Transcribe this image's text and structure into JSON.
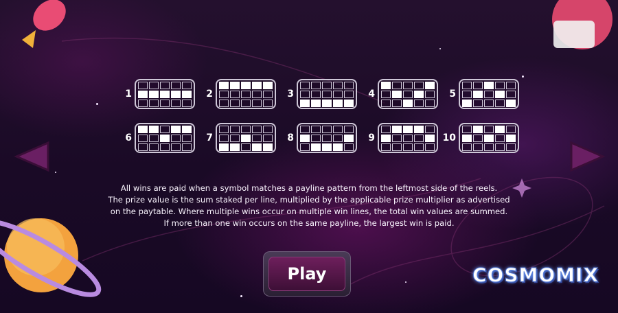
{
  "paylines": [
    {
      "number": "1",
      "rows": [
        [
          0,
          0,
          0,
          0,
          0
        ],
        [
          1,
          1,
          1,
          1,
          1
        ],
        [
          0,
          0,
          0,
          0,
          0
        ]
      ]
    },
    {
      "number": "2",
      "rows": [
        [
          1,
          1,
          1,
          1,
          1
        ],
        [
          0,
          0,
          0,
          0,
          0
        ],
        [
          0,
          0,
          0,
          0,
          0
        ]
      ]
    },
    {
      "number": "3",
      "rows": [
        [
          0,
          0,
          0,
          0,
          0
        ],
        [
          0,
          0,
          0,
          0,
          0
        ],
        [
          1,
          1,
          1,
          1,
          1
        ]
      ]
    },
    {
      "number": "4",
      "rows": [
        [
          1,
          0,
          0,
          0,
          1
        ],
        [
          0,
          1,
          0,
          1,
          0
        ],
        [
          0,
          0,
          1,
          0,
          0
        ]
      ]
    },
    {
      "number": "5",
      "rows": [
        [
          0,
          0,
          1,
          0,
          0
        ],
        [
          0,
          1,
          0,
          1,
          0
        ],
        [
          1,
          0,
          0,
          0,
          1
        ]
      ]
    },
    {
      "number": "6",
      "rows": [
        [
          1,
          1,
          0,
          1,
          1
        ],
        [
          0,
          0,
          1,
          0,
          0
        ],
        [
          0,
          0,
          0,
          0,
          0
        ]
      ]
    },
    {
      "number": "7",
      "rows": [
        [
          0,
          0,
          0,
          0,
          0
        ],
        [
          0,
          0,
          1,
          0,
          0
        ],
        [
          1,
          1,
          0,
          1,
          1
        ]
      ]
    },
    {
      "number": "8",
      "rows": [
        [
          0,
          0,
          0,
          0,
          0
        ],
        [
          1,
          0,
          0,
          0,
          1
        ],
        [
          0,
          1,
          1,
          1,
          0
        ]
      ]
    },
    {
      "number": "9",
      "rows": [
        [
          0,
          1,
          1,
          1,
          0
        ],
        [
          1,
          0,
          0,
          0,
          1
        ],
        [
          0,
          0,
          0,
          0,
          0
        ]
      ]
    },
    {
      "number": "10",
      "rows": [
        [
          0,
          1,
          0,
          1,
          0
        ],
        [
          1,
          0,
          1,
          0,
          1
        ],
        [
          0,
          0,
          0,
          0,
          0
        ]
      ]
    }
  ],
  "info_lines": [
    "All wins are paid when a symbol matches a payline pattern from the leftmost side of the reels.",
    "The prize value is the sum staked per line, multiplied by the applicable prize multiplier as advertised",
    "on the paytable. Where multiple wins occur on multiple win lines, the total win values are summed.",
    "If more than one win occurs on the same payline, the largest win is paid."
  ],
  "play_label": "Play",
  "logo_text": "COSMOMIX",
  "icons": {
    "prev": "triangle-left-arrow-icon",
    "next": "triangle-right-arrow-icon"
  },
  "colors": {
    "arrow_fill": "#6a1f63",
    "play_button": "#5a1a4e",
    "cell_on": "#ffffff",
    "cell_border": "#cfc8d8",
    "background": "#1e0c2a"
  }
}
